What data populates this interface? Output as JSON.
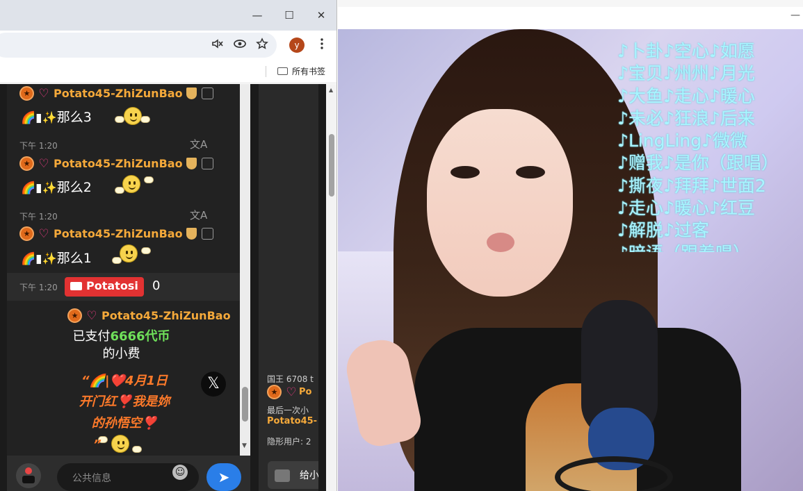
{
  "window": {
    "minimize_glyph": "—",
    "maximize_glyph": "☐",
    "close_glyph": "✕"
  },
  "toolbar": {
    "mute_icon": "tab-muted-icon",
    "eye_icon": "eye-icon",
    "star_icon": "star-bookmark-icon",
    "profile_initial": "y",
    "menu_icon": "kebab-menu-icon"
  },
  "bookmarks": {
    "all_bookmarks_label": "所有书签"
  },
  "chat": {
    "messages": [
      {
        "time": "",
        "user": "Potato45-ZhiZunBao",
        "text": "那么3"
      },
      {
        "time": "下午 1:20",
        "user": "Potato45-ZhiZunBao",
        "text": "那么2"
      },
      {
        "time": "下午 1:20",
        "user": "Potato45-ZhiZunBao",
        "text": "那么1"
      }
    ],
    "system": {
      "time": "下午 1:20",
      "badge": "Potatosi",
      "count": "0"
    },
    "tip": {
      "user": "Potato45-ZhiZunBao",
      "paid_prefix": "已支付",
      "amount": "6666代币",
      "suffix": "的小费",
      "quote_line1": "“🌈|❤️4月1日",
      "quote_line2": "开门红❣️我是妳",
      "quote_line3": "的孙悟空❣️",
      "quote_close": "”"
    },
    "input_placeholder": "公共信息",
    "send_label": "➤",
    "x_label": "𝕏"
  },
  "side_panel": {
    "king_label": "国王 6708 t",
    "king_user_short": "Po",
    "last_label": "最后一次小",
    "last_user": "Potato45-",
    "hidden_users": "隐形用户: 2",
    "gift_label": "给小"
  },
  "stream": {
    "songs": [
      "♪卜卦♪空心♪如愿",
      "♪宝贝♪州州♪月光",
      "♪大鱼♪走心♪暖心",
      "♪未必♪狂浪♪后来",
      "♪LingLing♪微微",
      "♪赠我♪是你（跟唱）",
      "♪撕夜♪拜拜♪世面2",
      "♪走心♪暖心♪红豆",
      "♪解脱♪过客",
      "♪暗语（跟着唱）"
    ]
  }
}
